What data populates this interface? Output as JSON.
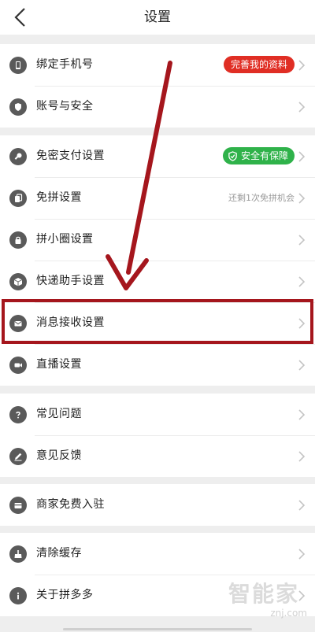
{
  "header": {
    "title": "设置",
    "back_icon": "chevron-left-icon"
  },
  "groups": [
    {
      "items": [
        {
          "key": "bind_phone",
          "label": "绑定手机号",
          "icon": "phone-icon",
          "badge": "完善我的资料"
        },
        {
          "key": "account_security",
          "label": "账号与安全",
          "icon": "shield-icon"
        }
      ]
    },
    {
      "items": [
        {
          "key": "pay_settings",
          "label": "免密支付设置",
          "icon": "key-icon",
          "badge": "安全有保障"
        },
        {
          "key": "free_group",
          "label": "免拼设置",
          "icon": "cards-icon",
          "hint": "还剩1次免拼机会"
        },
        {
          "key": "circle_settings",
          "label": "拼小圈设置",
          "icon": "lock-icon"
        },
        {
          "key": "delivery_assistant",
          "label": "快递助手设置",
          "icon": "package-icon"
        },
        {
          "key": "message_settings",
          "label": "消息接收设置",
          "icon": "mail-icon"
        },
        {
          "key": "live_settings",
          "label": "直播设置",
          "icon": "video-icon"
        }
      ]
    },
    {
      "items": [
        {
          "key": "faq",
          "label": "常见问题",
          "icon": "question-icon"
        },
        {
          "key": "feedback",
          "label": "意见反馈",
          "icon": "pencil-icon"
        }
      ]
    },
    {
      "items": [
        {
          "key": "merchant",
          "label": "商家免费入驻",
          "icon": "store-icon"
        }
      ]
    },
    {
      "items": [
        {
          "key": "clear_cache",
          "label": "清除缓存",
          "icon": "broom-icon"
        },
        {
          "key": "about",
          "label": "关于拼多多",
          "icon": "info-icon"
        }
      ]
    }
  ],
  "watermark": {
    "text": "智能家",
    "sub": "znj.com"
  },
  "colors": {
    "accent_red": "#e02e24",
    "accent_green": "#2fb24a",
    "annotation": "#a5161d"
  }
}
